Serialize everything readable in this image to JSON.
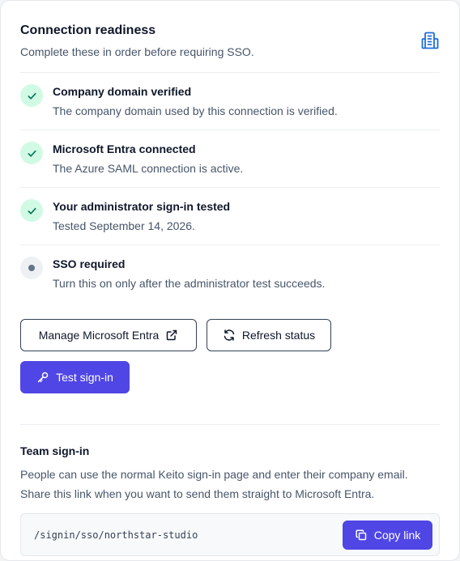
{
  "header": {
    "title": "Connection readiness",
    "subtitle": "Complete these in order before requiring SSO.",
    "icon": "building-icon"
  },
  "steps": [
    {
      "title": "Company domain verified",
      "description": "The company domain used by this connection is verified.",
      "status": "done"
    },
    {
      "title": "Microsoft Entra connected",
      "description": "The Azure SAML connection is active.",
      "status": "done"
    },
    {
      "title": "Your administrator sign-in tested",
      "description": "Tested September 14, 2026.",
      "status": "done"
    },
    {
      "title": "SSO required",
      "description": "Turn this on only after the administrator test succeeds.",
      "status": "pending"
    }
  ],
  "actions": {
    "manage_label": "Manage Microsoft Entra",
    "refresh_label": "Refresh status",
    "test_label": "Test sign-in"
  },
  "team": {
    "title": "Team sign-in",
    "description_line1": "People can use the normal Keito sign-in page and enter their company email.",
    "description_line2": "Share this link when you want to send them straight to Microsoft Entra.",
    "link": "/signin/sso/northstar-studio",
    "copy_label": "Copy link"
  },
  "colors": {
    "accent": "#4f46e5",
    "success_bg": "#d1fae5",
    "success_fg": "#047857",
    "icon_blue": "#1d6fd8"
  }
}
